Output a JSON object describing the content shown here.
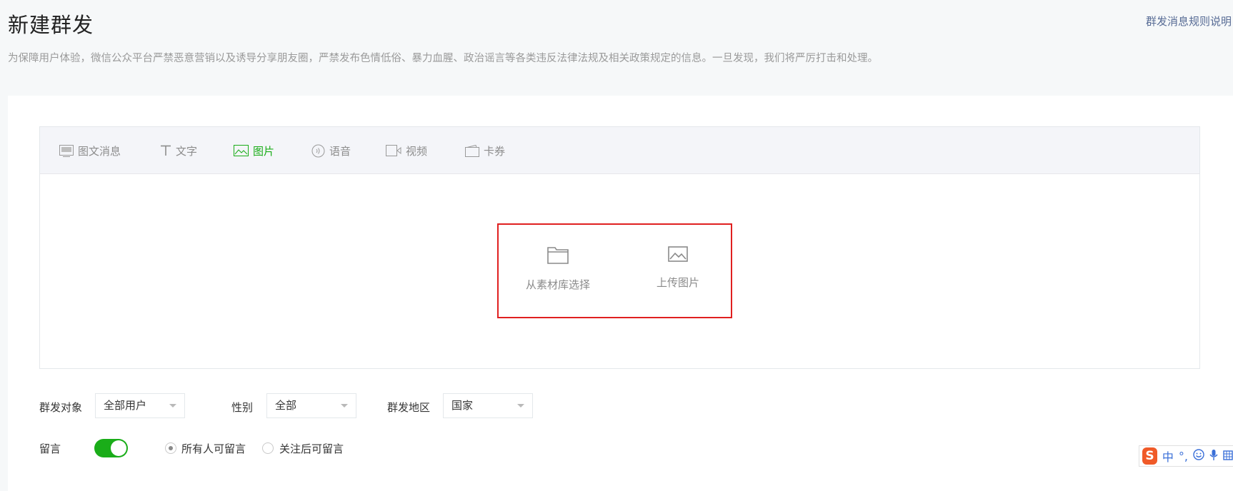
{
  "header": {
    "title": "新建群发",
    "rules_link": "群发消息规则说明",
    "notice": "为保障用户体验，微信公众平台严禁恶意营销以及诱导分享朋友圈，严禁发布色情低俗、暴力血腥、政治谣言等各类违反法律法规及相关政策规定的信息。一旦发现，我们将严厉打击和处理。"
  },
  "tabs": [
    {
      "label": "图文消息",
      "icon": "news-icon",
      "active": false
    },
    {
      "label": "文字",
      "icon": "text-icon",
      "active": false
    },
    {
      "label": "图片",
      "icon": "image-icon",
      "active": true
    },
    {
      "label": "语音",
      "icon": "voice-icon",
      "active": false
    },
    {
      "label": "视频",
      "icon": "video-icon",
      "active": false
    },
    {
      "label": "卡券",
      "icon": "card-icon",
      "active": false
    }
  ],
  "upload": {
    "library_label": "从素材库选择",
    "upload_label": "上传图片"
  },
  "filters": {
    "target_label": "群发对象",
    "target_value": "全部用户",
    "gender_label": "性别",
    "gender_value": "全部",
    "region_label": "群发地区",
    "region_value": "国家"
  },
  "comment": {
    "label": "留言",
    "enabled": true,
    "option_all": "所有人可留言",
    "option_followers": "关注后可留言",
    "selected": "option_all"
  },
  "ime": {
    "logo": "S",
    "mode": "中",
    "punct": "°,"
  },
  "colors": {
    "accent": "#1aad19",
    "link": "#576b95",
    "highlight_border": "#e02020"
  }
}
